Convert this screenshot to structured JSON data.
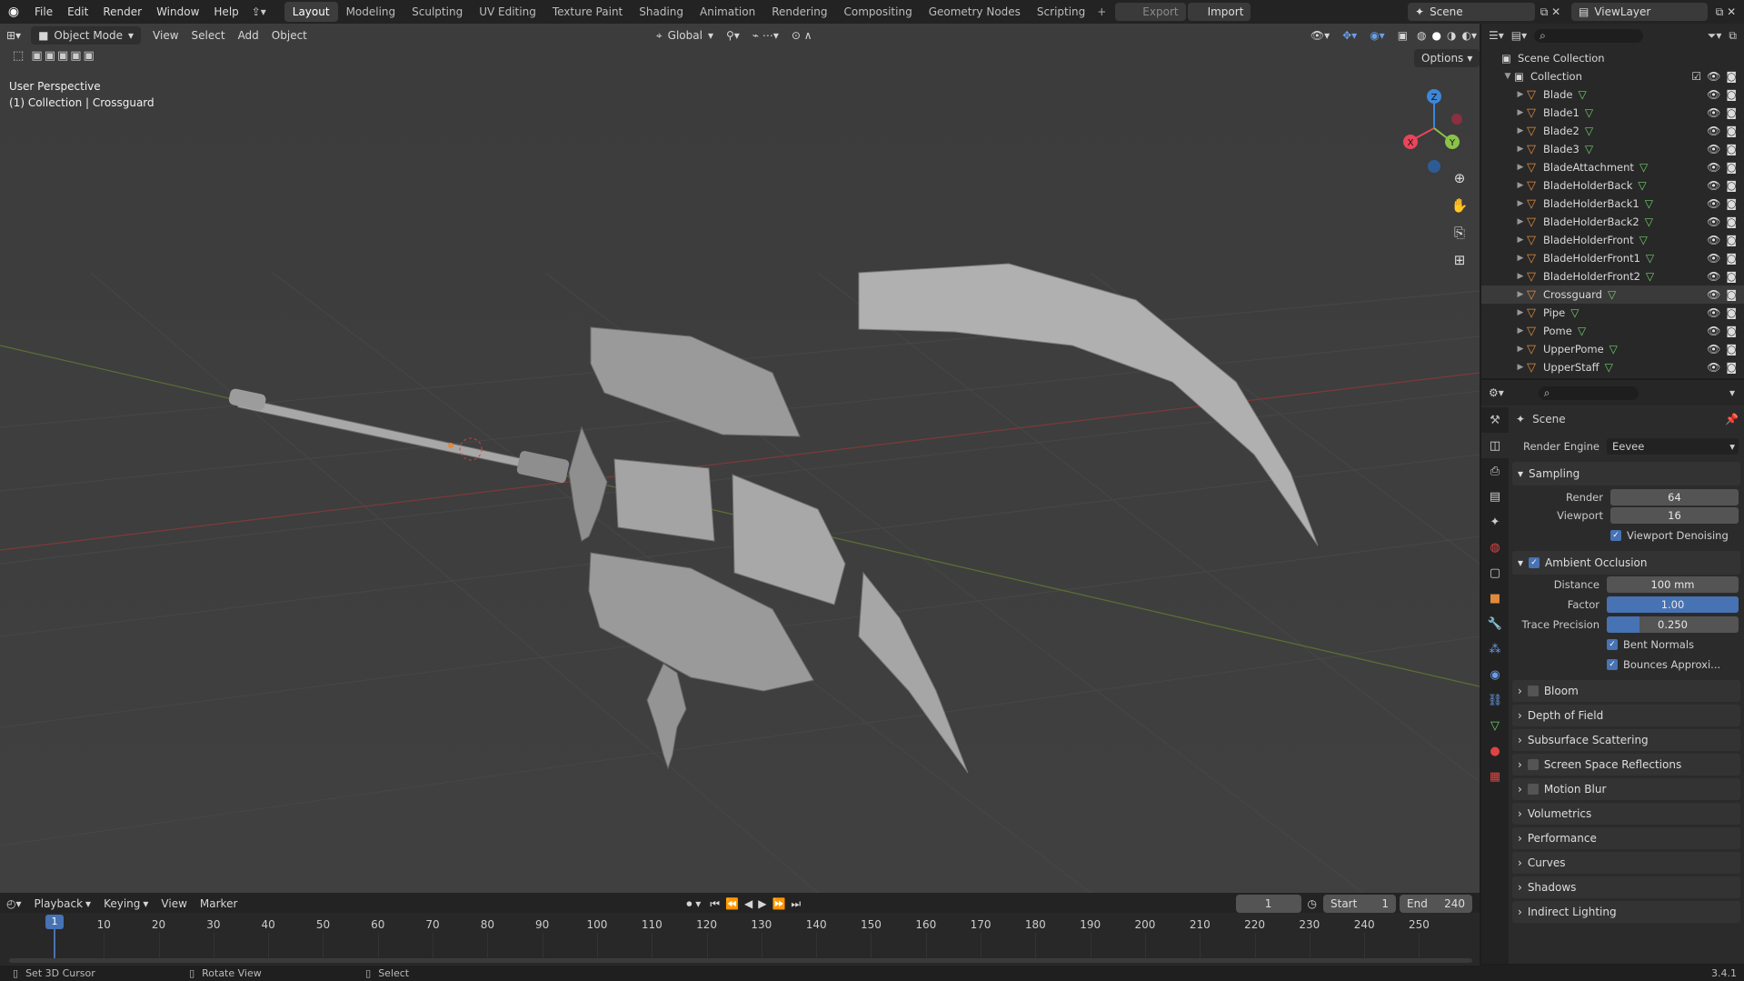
{
  "topbar": {
    "menus": [
      "File",
      "Edit",
      "Render",
      "Window",
      "Help"
    ],
    "workspaces": [
      "Layout",
      "Modeling",
      "Sculpting",
      "UV Editing",
      "Texture Paint",
      "Shading",
      "Animation",
      "Rendering",
      "Compositing",
      "Geometry Nodes",
      "Scripting"
    ],
    "export_label": "Export",
    "import_label": "Import",
    "scene": "Scene",
    "view_layer": "ViewLayer"
  },
  "viewport": {
    "mode": "Object Mode",
    "menus": [
      "View",
      "Select",
      "Add",
      "Object"
    ],
    "orientation": "Global",
    "options_label": "Options",
    "perspective": "User Perspective",
    "context": "(1) Collection | Crossguard",
    "gizmo": {
      "x": "X",
      "y": "Y",
      "z": "Z"
    }
  },
  "outliner": {
    "root": "Scene Collection",
    "collection": "Collection",
    "items": [
      "Blade",
      "Blade1",
      "Blade2",
      "Blade3",
      "BladeAttachment",
      "BladeHolderBack",
      "BladeHolderBack1",
      "BladeHolderBack2",
      "BladeHolderFront",
      "BladeHolderFront1",
      "BladeHolderFront2",
      "Crossguard",
      "Pipe",
      "Pome",
      "UpperPome",
      "UpperStaff"
    ],
    "selected": "Crossguard"
  },
  "properties": {
    "context": "Scene",
    "render_engine_label": "Render Engine",
    "render_engine": "Eevee",
    "sampling": {
      "title": "Sampling",
      "render_label": "Render",
      "render": "64",
      "viewport_label": "Viewport",
      "viewport": "16",
      "denoise": "Viewport Denoising"
    },
    "ao": {
      "title": "Ambient Occlusion",
      "distance_label": "Distance",
      "distance": "100 mm",
      "factor_label": "Factor",
      "factor": "1.00",
      "factor_fill": 1.0,
      "trace_label": "Trace Precision",
      "trace": "0.250",
      "trace_fill": 0.25,
      "bent": "Bent Normals",
      "bounces": "Bounces Approxi..."
    },
    "panels": [
      {
        "label": "Bloom",
        "checkbox": true
      },
      {
        "label": "Depth of Field",
        "checkbox": false
      },
      {
        "label": "Subsurface Scattering",
        "checkbox": false
      },
      {
        "label": "Screen Space Reflections",
        "checkbox": true
      },
      {
        "label": "Motion Blur",
        "checkbox": true
      },
      {
        "label": "Volumetrics",
        "checkbox": false
      },
      {
        "label": "Performance",
        "checkbox": false
      },
      {
        "label": "Curves",
        "checkbox": false
      },
      {
        "label": "Shadows",
        "checkbox": false
      },
      {
        "label": "Indirect Lighting",
        "checkbox": false
      }
    ]
  },
  "timeline": {
    "menus": [
      "Playback",
      "Keying",
      "View",
      "Marker"
    ],
    "current_frame": "1",
    "start_label": "Start",
    "start": "1",
    "end_label": "End",
    "end": "240",
    "ticks": [
      "10",
      "20",
      "30",
      "40",
      "50",
      "60",
      "70",
      "80",
      "90",
      "100",
      "110",
      "120",
      "130",
      "140",
      "150",
      "160",
      "170",
      "180",
      "190",
      "200",
      "210",
      "220",
      "230",
      "240",
      "250"
    ],
    "playhead": "1"
  },
  "statusbar": {
    "left": "Set 3D Cursor",
    "middle": "Rotate View",
    "right": "Select",
    "version": "3.4.1"
  },
  "colors": {
    "accent": "#4772b3",
    "object": "#e08a3c",
    "mesh": "#6fd06a",
    "axis_x": "#e8455b",
    "axis_y": "#8bc34a",
    "axis_z": "#3d87d9"
  }
}
